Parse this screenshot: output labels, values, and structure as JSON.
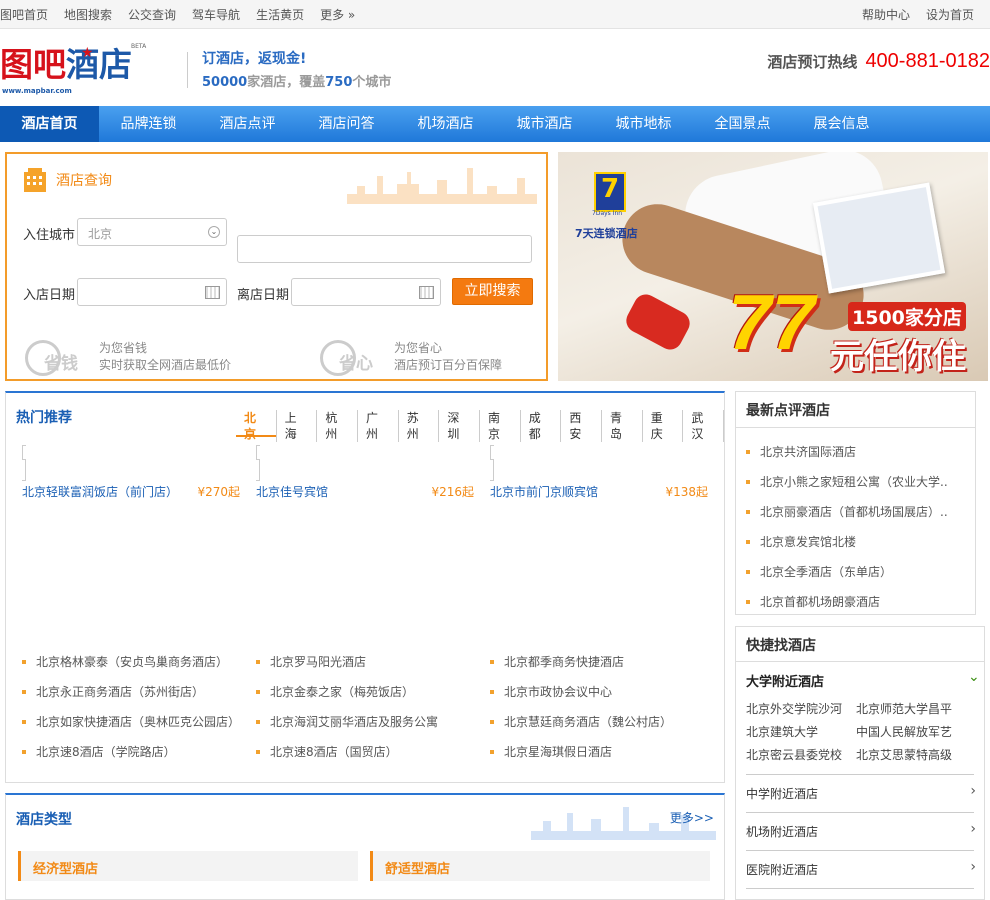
{
  "topbar": {
    "left_links": [
      "图吧首页",
      "地图搜索",
      "公交查询",
      "驾车导航",
      "生活黄页",
      "更多 »"
    ],
    "right_links": [
      "帮助中心",
      "设为首页"
    ]
  },
  "header": {
    "logo_text_red": "图吧",
    "logo_text_blue": "酒店",
    "logo_url": "www.mapbar.com",
    "logo_beta": "BETA",
    "slogan_line1": "订酒店，返现金!",
    "slogan_line2_a": "50000",
    "slogan_line2_b": "家酒店，覆盖",
    "slogan_line2_c": "750",
    "slogan_line2_d": "个城市",
    "hotline_label": "酒店预订热线",
    "hotline_number": "400-881-0182"
  },
  "nav": {
    "items": [
      "酒店首页",
      "品牌连锁",
      "酒店点评",
      "酒店问答",
      "机场酒店",
      "城市酒店",
      "城市地标",
      "全国景点",
      "展会信息"
    ],
    "active_index": 0
  },
  "search": {
    "title": "酒店查询",
    "city_label": "入住城市",
    "city_value": "北京",
    "checkin_label": "入店日期",
    "checkout_label": "离店日期",
    "button": "立即搜索",
    "perk1_badge": "省钱",
    "perk1_line1": "为您省钱",
    "perk1_line2": "实时获取全网酒店最低价",
    "perk2_badge": "省心",
    "perk2_line1": "为您省心",
    "perk2_line2": "酒店预订百分百保障"
  },
  "banner": {
    "brand_mark": "7",
    "brand_sub": "7Days Inn",
    "brand_name": "7天连锁酒店",
    "big_number": "77",
    "stores": "1500家分店",
    "slogan": "元任你住"
  },
  "hot": {
    "title": "热门推荐",
    "cities": [
      "北京",
      "上海",
      "杭州",
      "广州",
      "苏州",
      "深圳",
      "南京",
      "成都",
      "西安",
      "青岛",
      "重庆",
      "武汉"
    ],
    "active_city": 0,
    "cards": [
      {
        "name": "北京轻联富润饭店（前门店）",
        "price": "¥270起"
      },
      {
        "name": "北京佳号宾馆",
        "price": "¥216起"
      },
      {
        "name": "北京市前门京顺宾馆",
        "price": "¥138起"
      }
    ],
    "lists": [
      [
        "北京格林豪泰（安贞鸟巢商务酒店）",
        "北京永正商务酒店（苏州街店）",
        "北京如家快捷酒店（奥林匹克公园店）",
        "北京速8酒店（学院路店）"
      ],
      [
        "北京罗马阳光酒店",
        "北京金泰之家（梅苑饭店）",
        "北京海润艾丽华酒店及服务公寓",
        "北京速8酒店（国贸店）"
      ],
      [
        "北京都季商务快捷酒店",
        "北京市政协会议中心",
        "北京慧廷商务酒店（魏公村店）",
        "北京星海琪假日酒店"
      ]
    ]
  },
  "reviews": {
    "title": "最新点评酒店",
    "items": [
      "北京共济国际酒店",
      "北京小熊之家短租公寓（农业大学..",
      "北京丽豪酒店（首都机场国展店）..",
      "北京意发宾馆北楼",
      "北京全季酒店（东单店）",
      "北京首都机场朗豪酒店"
    ]
  },
  "quick": {
    "title": "快捷找酒店",
    "section_title": "大学附近酒店",
    "universities": [
      "北京外交学院沙河",
      "北京师范大学昌平",
      "北京建筑大学",
      "中国人民解放军艺",
      "北京密云县委党校",
      "北京艾思蒙特高级"
    ],
    "rows": [
      "中学附近酒店",
      "机场附近酒店",
      "医院附近酒店"
    ]
  },
  "types": {
    "title": "酒店类型",
    "more": "更多>>",
    "tabs": [
      "经济型酒店",
      "舒适型酒店"
    ]
  },
  "colors": {
    "accent_orange": "#f28a16",
    "nav_blue": "#1f78d9",
    "link_blue": "#1a5fb4",
    "hotline_red": "#e00000"
  }
}
